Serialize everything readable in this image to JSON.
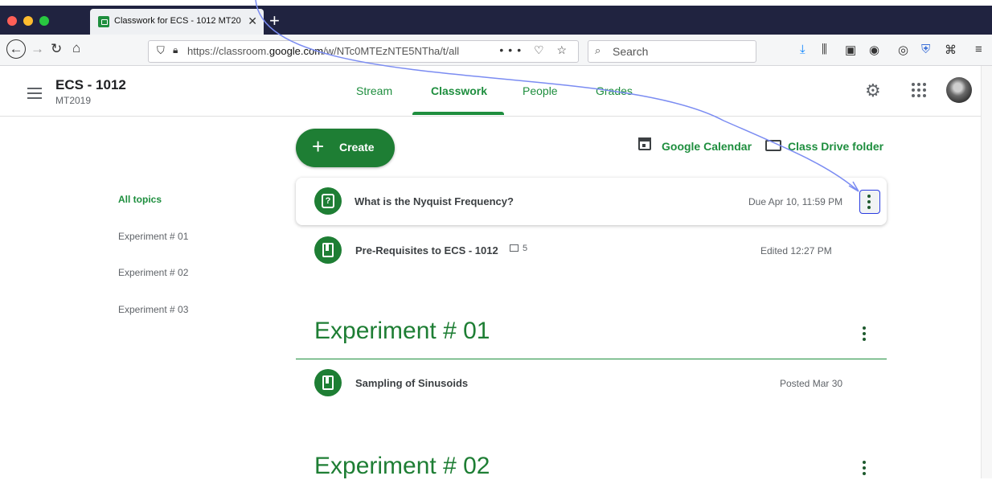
{
  "browser": {
    "tab_title": "Classwork for ECS - 1012 MT20",
    "tab_close": "✕",
    "new_tab": "+",
    "url_prefix": "https://classroom.",
    "url_domain": "google.com",
    "url_path": "/w/NTc0MTEzNTE5NTha/t/all",
    "url_meta": "••• ♡ ☆",
    "search_placeholder": "Search",
    "window_dots": [
      "#fe5f57",
      "#febc2e",
      "#28c840"
    ]
  },
  "header": {
    "class_name": "ECS - 1012",
    "class_section": "MT2019",
    "tabs": [
      {
        "label": "Stream"
      },
      {
        "label": "Classwork",
        "active": true
      },
      {
        "label": "People"
      },
      {
        "label": "Grades"
      }
    ]
  },
  "actions": {
    "create_label": "Create",
    "calendar_label": "Google Calendar",
    "drive_label": "Class Drive folder"
  },
  "topics": [
    "All topics",
    "Experiment # 01",
    "Experiment # 02",
    "Experiment # 03"
  ],
  "items": [
    {
      "title": "What is the Nyquist Frequency?",
      "meta": "Due Apr 10, 11:59 PM",
      "icon": "question-assignment-icon",
      "icon_glyph": "?"
    },
    {
      "title": "Pre-Requisites to ECS - 1012",
      "meta": "Edited 12:27 PM",
      "icon": "material-icon",
      "comments": "5"
    }
  ],
  "sections": [
    {
      "title": "Experiment # 01",
      "items": [
        {
          "title": "Sampling of Sinusoids",
          "meta": "Posted Mar 30",
          "icon": "material-icon"
        }
      ]
    },
    {
      "title": "Experiment # 02",
      "items": []
    }
  ],
  "colors": {
    "accent": "#1e8e3e",
    "tabbar": "#202340",
    "annotation": "#7b8cf2"
  }
}
